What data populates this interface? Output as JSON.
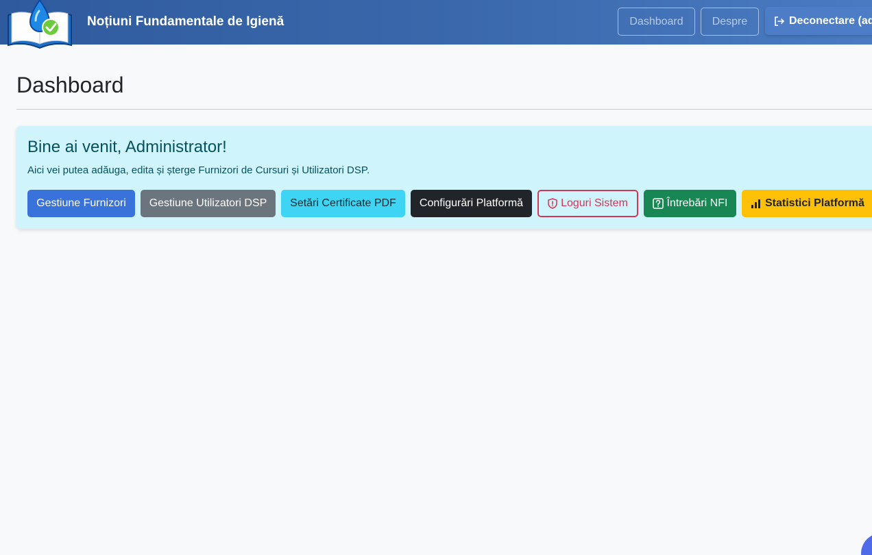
{
  "navbar": {
    "brand": "Noțiuni Fundamentale de Igienă",
    "logo_icon": "book-water-drop-check-icon",
    "links": {
      "dashboard": "Dashboard",
      "despre": "Despre"
    },
    "logout": {
      "label": "Deconectare (ad",
      "icon": "logout-icon"
    }
  },
  "page": {
    "title": "Dashboard"
  },
  "welcome": {
    "title": "Bine ai venit, Administrator!",
    "text": "Aici vei putea adăuga, edita și șterge Furnizori de Cursuri și Utilizatori DSP."
  },
  "actions": {
    "furnizori": "Gestiune Furnizori",
    "utilizatori": "Gestiune Utilizatori DSP",
    "certificate": "Setări Certificate PDF",
    "configurari": "Configurări Platformă",
    "loguri": "Loguri Sistem",
    "intrebari": "Întrebări NFI",
    "statistici": "Statistici Platformă"
  },
  "colors": {
    "navbar": "#3a67ab",
    "info_bg": "#cff4fc",
    "primary": "#3a72dc",
    "secondary": "#6c757d",
    "info": "#3dd5f3",
    "dark": "#212529",
    "danger": "#d63454",
    "success": "#198754",
    "warning": "#ffc107"
  }
}
